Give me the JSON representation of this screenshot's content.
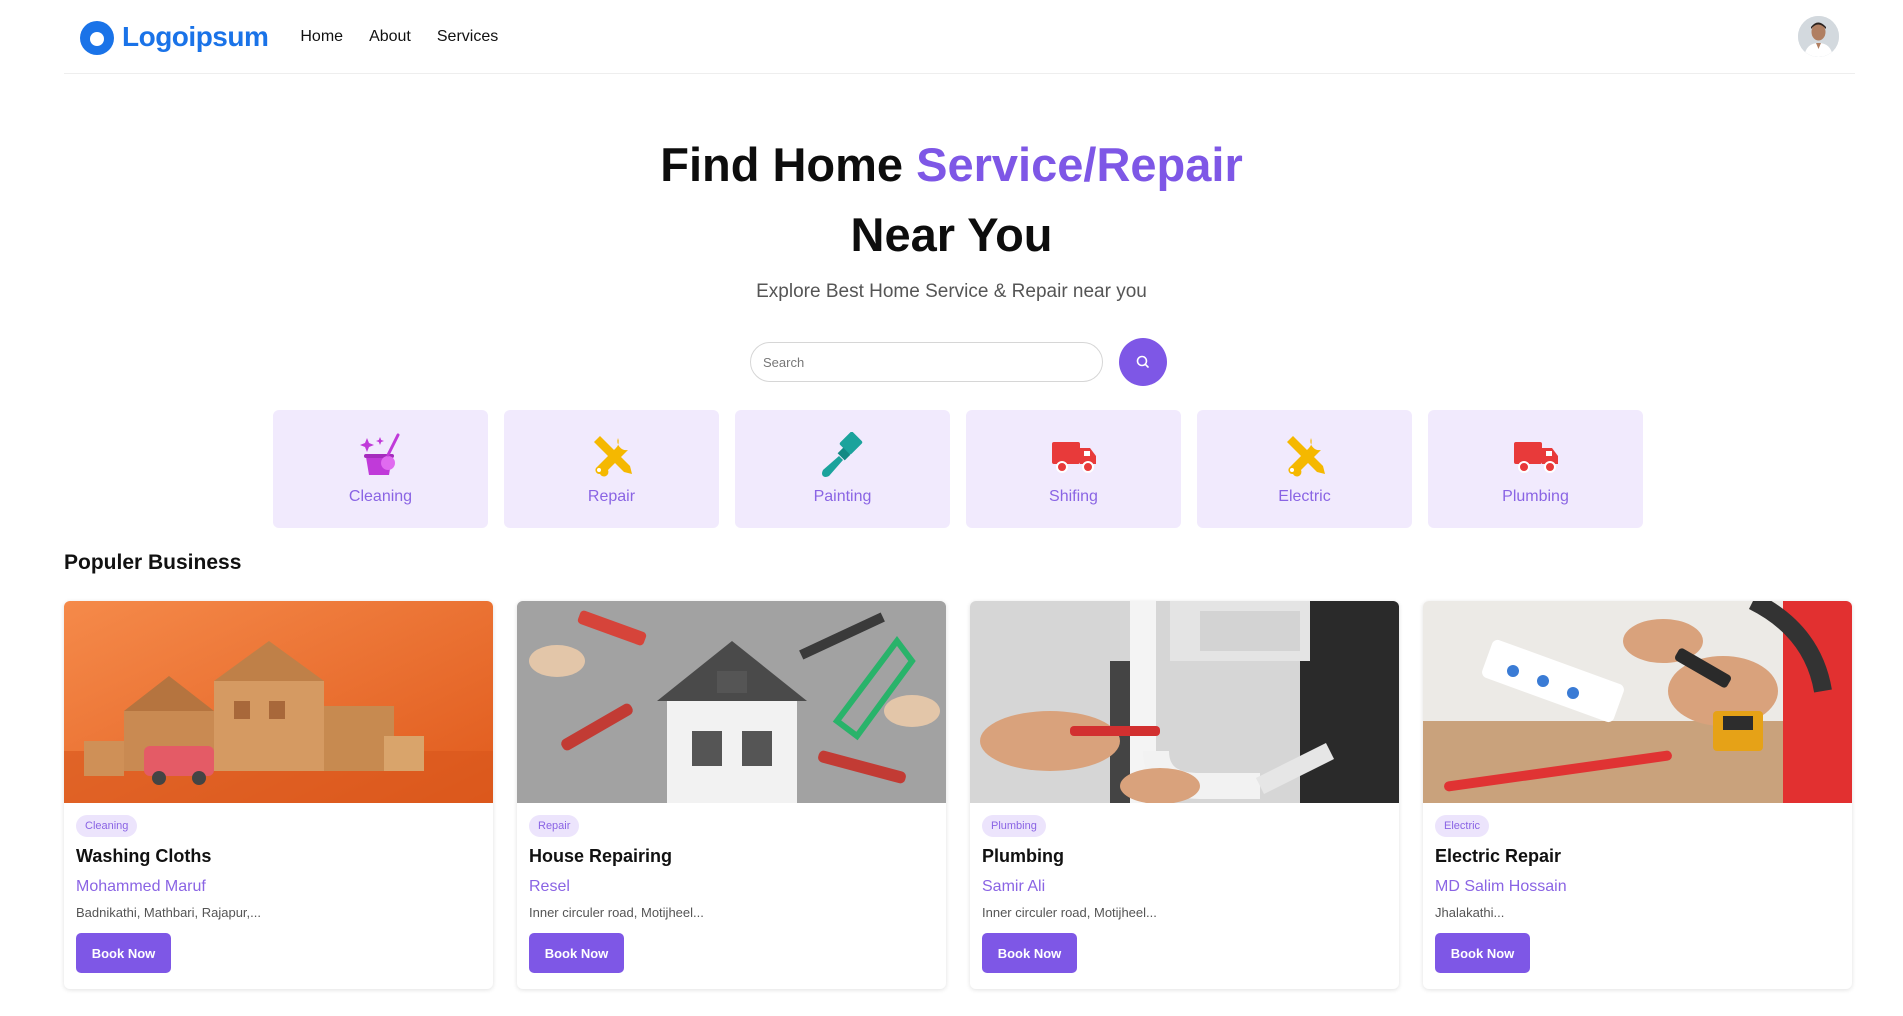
{
  "header": {
    "logo_text": "Logoipsum",
    "nav": [
      {
        "label": "Home"
      },
      {
        "label": "About"
      },
      {
        "label": "Services"
      }
    ]
  },
  "hero": {
    "title_part1": "Find Home ",
    "title_accent": "Service/Repair",
    "title_line2": "Near You",
    "subtitle": "Explore Best Home Service & Repair near you"
  },
  "search": {
    "placeholder": "Search",
    "value": ""
  },
  "categories": [
    {
      "label": "Cleaning",
      "icon": "cleaning-icon",
      "color": "#c03ad9"
    },
    {
      "label": "Repair",
      "icon": "tools-icon",
      "color": "#f5b800"
    },
    {
      "label": "Painting",
      "icon": "paintbrush-icon",
      "color": "#1ba39c"
    },
    {
      "label": "Shifing",
      "icon": "truck-icon",
      "color": "#e83a3a"
    },
    {
      "label": "Electric",
      "icon": "tools-icon",
      "color": "#f5b800"
    },
    {
      "label": "Plumbing",
      "icon": "truck-icon",
      "color": "#e83a3a"
    }
  ],
  "popular": {
    "title": "Populer Business",
    "businesses": [
      {
        "tag": "Cleaning",
        "name": "Washing Cloths",
        "owner": "Mohammed Maruf",
        "address": "Badnikathi, Mathbari, Rajapur,...",
        "button": "Book Now",
        "image": "moving-boxes-image"
      },
      {
        "tag": "Repair",
        "name": "House Repairing",
        "owner": "Resel",
        "address": "Inner circuler road, Motijheel...",
        "button": "Book Now",
        "image": "house-tools-image"
      },
      {
        "tag": "Plumbing",
        "name": "Plumbing",
        "owner": "Samir Ali",
        "address": "Inner circuler road, Motijheel...",
        "button": "Book Now",
        "image": "pipe-repair-image"
      },
      {
        "tag": "Electric",
        "name": "Electric Repair",
        "owner": "MD Salim Hossain",
        "address": "Jhalakathi...",
        "button": "Book Now",
        "image": "electrician-image"
      }
    ]
  },
  "colors": {
    "accent": "#7e57e6",
    "logo": "#1a73e8",
    "category_bg": "#f1eafd"
  }
}
